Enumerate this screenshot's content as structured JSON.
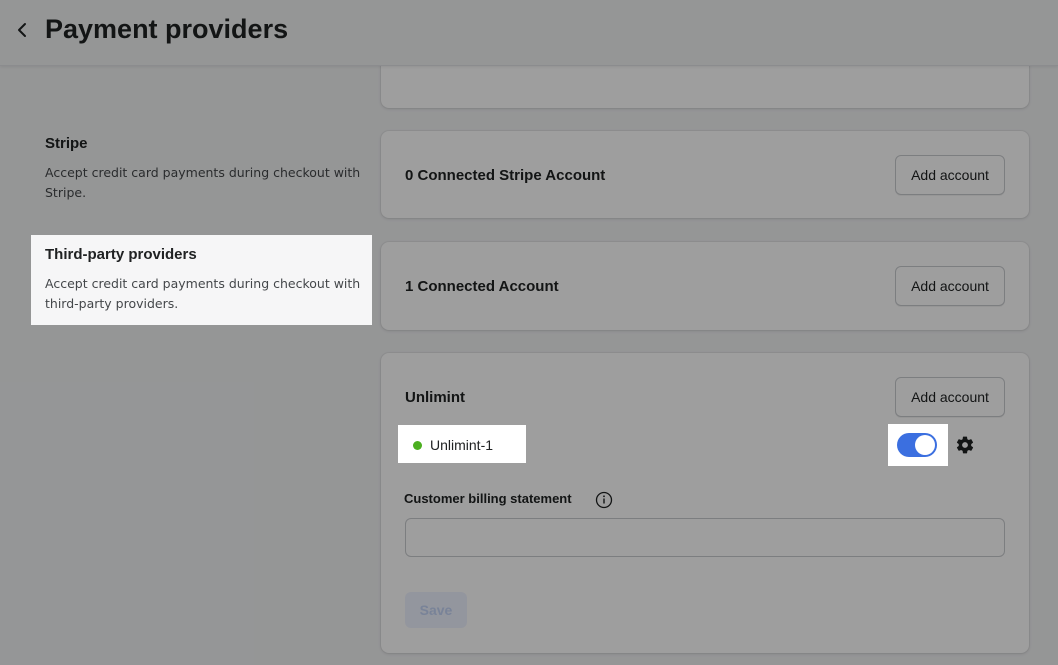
{
  "header": {
    "title": "Payment providers"
  },
  "sections": {
    "stripe": {
      "title": "Stripe",
      "description": "Accept credit card payments during checkout with Stripe."
    },
    "third_party": {
      "title": "Third-party providers",
      "description": "Accept credit card payments during checkout with third-party providers."
    }
  },
  "cards": {
    "stripe": {
      "heading": "0 Connected Stripe Account",
      "add_label": "Add account"
    },
    "third_party": {
      "heading": "1 Connected Account",
      "add_label": "Add account"
    },
    "unlimint": {
      "heading": "Unlimint",
      "add_label": "Add account",
      "account_name": "Unlimint-1",
      "account_status_color": "#4caf20",
      "toggle_on": true,
      "billing_label": "Customer billing statement",
      "billing_value": "",
      "save_label": "Save"
    }
  },
  "colors": {
    "accent": "#3b6fe0",
    "status_active": "#4caf20"
  },
  "icons": {
    "back": "chevron-left-icon",
    "settings": "gear-icon",
    "info": "info-icon"
  }
}
